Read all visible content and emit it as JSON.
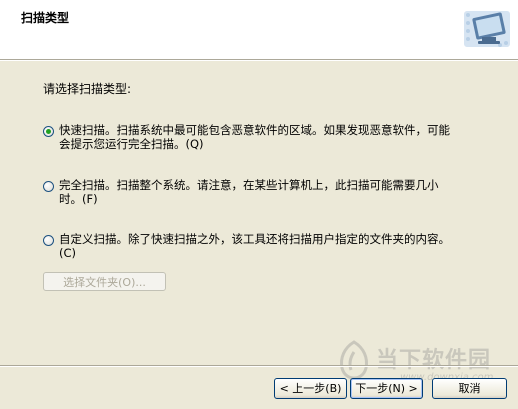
{
  "header": {
    "title": "扫描类型",
    "icon": "scan-monitor-icon"
  },
  "prompt": "请选择扫描类型:",
  "options": [
    {
      "label": "快速扫描。扫描系统中最可能包含恶意软件的区域。如果发现恶意软件，可能\n会提示您运行完全扫描。(Q)",
      "checked": true
    },
    {
      "label": "完全扫描。扫描整个系统。请注意，在某些计算机上，此扫描可能需要几小\n时。(F)",
      "checked": false
    },
    {
      "label": "自定义扫描。除了快速扫描之外，该工具还将扫描用户指定的文件夹的内容。\n(C)",
      "checked": false
    }
  ],
  "choose_folder_label": "选择文件夹(O)...",
  "buttons": {
    "back": "< 上一步(B)",
    "next": "下一步(N) >",
    "cancel": "取消"
  },
  "watermark": {
    "text": "当下软件园",
    "url": "www.downxia.com"
  },
  "colors": {
    "header_bg": "#ffffff",
    "dialog_bg": "#ece9d8",
    "radio_dot": "#21a121"
  }
}
